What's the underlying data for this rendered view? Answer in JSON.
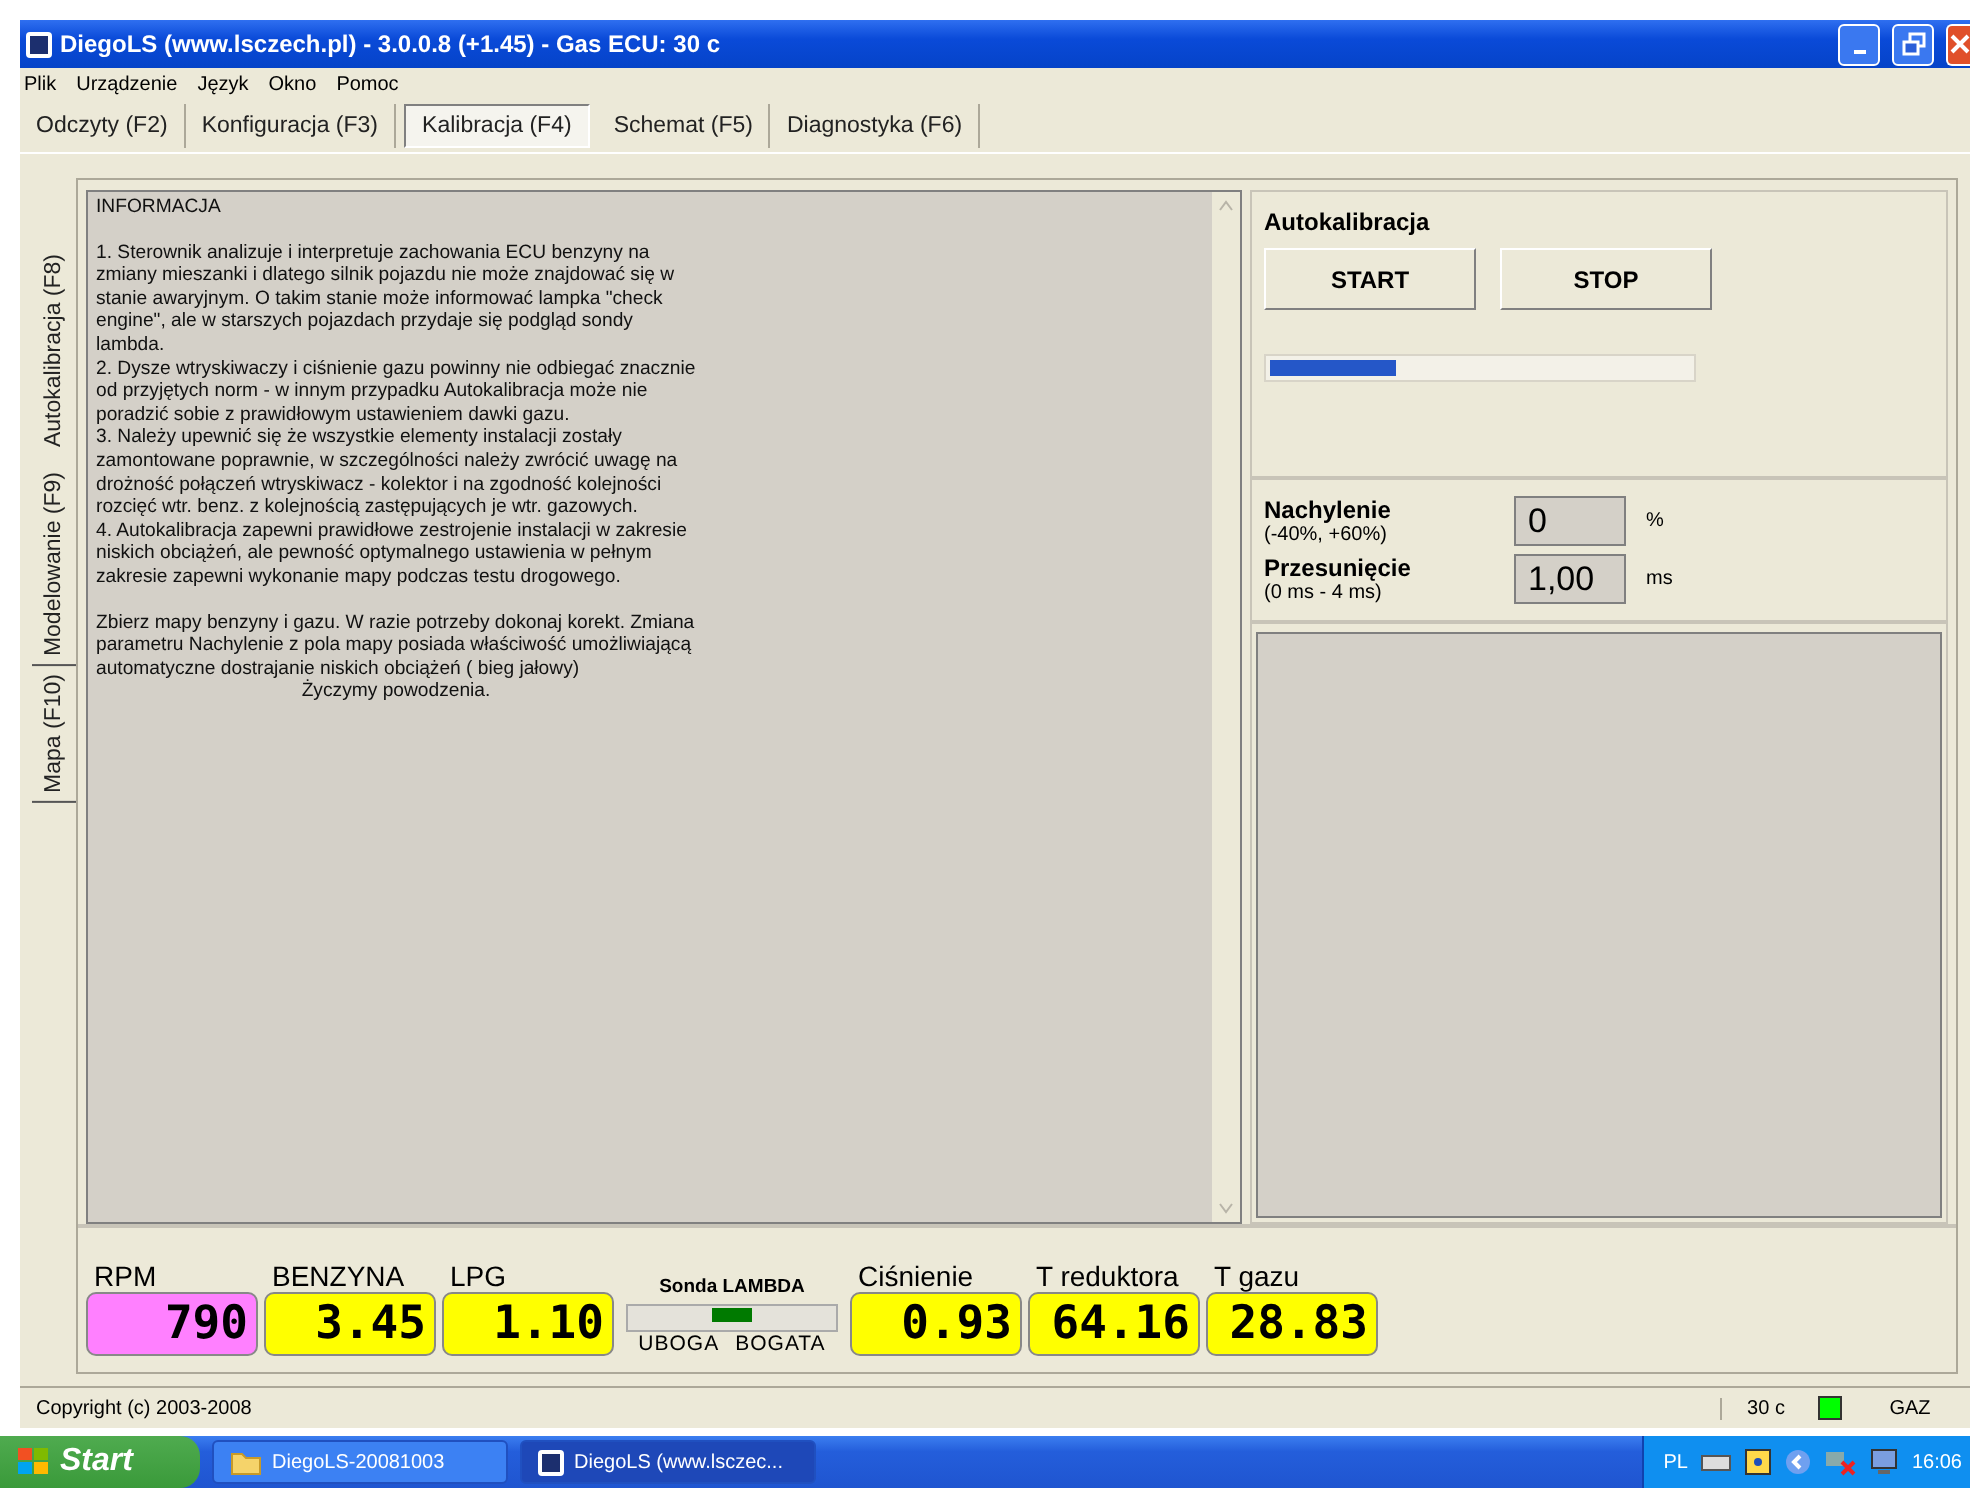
{
  "window": {
    "title": "DiegoLS (www.lsczech.pl) - 3.0.0.8 (+1.45) - Gas ECU: 30 c"
  },
  "menu": [
    "Plik",
    "Urządzenie",
    "Język",
    "Okno",
    "Pomoc"
  ],
  "tabs": [
    {
      "label": "Odczyty (F2)",
      "selected": false
    },
    {
      "label": "Konfiguracja (F3)",
      "selected": false
    },
    {
      "label": "Kalibracja (F4)",
      "selected": true
    },
    {
      "label": "Schemat (F5)",
      "selected": false
    },
    {
      "label": "Diagnostyka (F6)",
      "selected": false
    }
  ],
  "side_tabs": [
    {
      "label": "Autokalibracja (F8)",
      "selected": true
    },
    {
      "label": "Modelowanie (F9)",
      "selected": false
    },
    {
      "label": "Mapa (F10)",
      "selected": false
    }
  ],
  "info": {
    "heading": "INFORMACJA",
    "paragraphs": [
      "1. Sterownik analizuje i interpretuje zachowania ECU benzyny na zmiany mieszanki i dlatego silnik pojazdu nie może znajdować się w stanie awaryjnym. O takim stanie może informować lampka \"check engine\", ale w starszych pojazdach przydaje się podgląd sondy lambda.",
      "2. Dysze wtryskiwaczy i ciśnienie gazu powinny nie odbiegać znacznie od przyjętych norm - w innym przypadku Autokalibracja może nie poradzić sobie z prawidłowym ustawieniem dawki gazu.",
      "3. Należy upewnić się że wszystkie elementy instalacji zostały zamontowane poprawnie, w szczególności należy zwrócić uwagę na drożność połączeń wtryskiwacz - kolektor i na zgodność kolejności rozcięć wtr. benz. z kolejnością zastępujących je wtr. gazowych.",
      "4. Autokalibracja zapewni prawidłowe zestrojenie instalacji w zakresie niskich obciążeń, ale pewność optymalnego ustawienia w pełnym zakresie zapewni wykonanie mapy podczas testu drogowego.",
      "Zbierz mapy benzyny i gazu. W razie potrzeby dokonaj korekt. Zmiana parametru Nachylenie z pola mapy posiada właściwość umożliwiającą automatyczne dostrajanie niskich obciążeń ( bieg jałowy)"
    ],
    "closing": "Życzymy powodzenia."
  },
  "autocalibration": {
    "title": "Autokalibracja",
    "buttons": [
      "START",
      "STOP"
    ],
    "progress": {
      "level": 0.3
    }
  },
  "params": [
    {
      "name": "Nachylenie",
      "range": "(-40%, +60%)",
      "value": "0",
      "unit": "%"
    },
    {
      "name": "Przesunięcie",
      "range": "(0 ms - 4 ms)",
      "value": "1,00",
      "unit": "ms"
    }
  ],
  "gauges": [
    {
      "label": "RPM",
      "value": "790",
      "color": "#ff80ff"
    },
    {
      "label": "BENZYNA",
      "value": "3.45",
      "color": "#ffff00"
    },
    {
      "label": "LPG",
      "value": "1.10",
      "color": "#ffff00"
    }
  ],
  "lambda": {
    "title": "Sonda LAMBDA",
    "level": 0.5,
    "left": "UBOGA",
    "right": "BOGATA"
  },
  "gauges_2": [
    {
      "label": "Ciśnienie",
      "value": "0.93",
      "color": "#ffff00"
    },
    {
      "label": "T reduktora",
      "value": "64.16",
      "color": "#ffff00"
    },
    {
      "label": "T gazu",
      "value": "28.83",
      "color": "#ffff00"
    }
  ],
  "status_bar": {
    "copyright": "Copyright (c) 2003-2008",
    "temperature": "30 c",
    "indicator_on": true,
    "mode": "GAZ"
  },
  "taskbar": {
    "start": "Start",
    "tasks": [
      {
        "label": "DiegoLS-20081003",
        "kind": "folder",
        "selected": false
      },
      {
        "label": "DiegoLS (www.lsczec...",
        "kind": "app",
        "selected": true
      }
    ],
    "language": "PL",
    "clock": "16:06"
  }
}
